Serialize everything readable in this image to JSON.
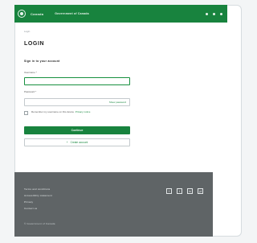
{
  "header": {
    "brand": "Canada",
    "tagline": "Government of Canada"
  },
  "breadcrumb": "Login",
  "page": {
    "title": "LOGIN",
    "subtitle": "Sign in to your account"
  },
  "form": {
    "username_label": "Username *",
    "username_value": "",
    "password_label": "Password *",
    "password_value": "",
    "show_password_label": "Show password",
    "remember_text": "Remember my username on this device. ",
    "remember_link": "Privacy notice",
    "submit_label": "Continue",
    "secondary_label": "Create account",
    "secondary_icon": "+"
  },
  "footer": {
    "links": [
      "Terms and conditions",
      "Accessibility statement",
      "Privacy",
      "Contact us"
    ],
    "social": [
      "f",
      "t",
      "in",
      "yt"
    ],
    "copyright": "© Government of Canada"
  }
}
